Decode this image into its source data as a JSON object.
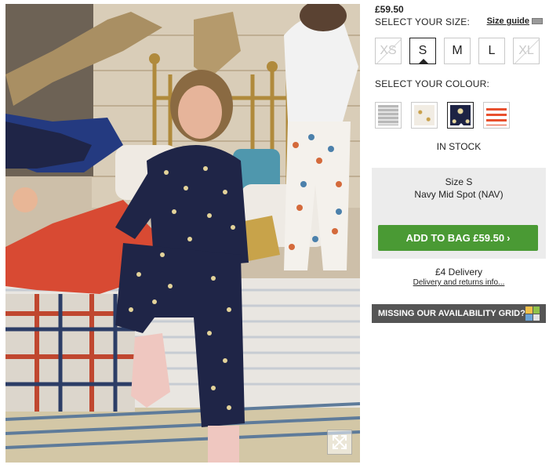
{
  "product": {
    "price": "£59.50",
    "size_label": "SELECT YOUR SIZE:",
    "size_guide": "Size guide",
    "sizes": [
      {
        "label": "XS",
        "available": false,
        "selected": false
      },
      {
        "label": "S",
        "available": true,
        "selected": true
      },
      {
        "label": "M",
        "available": true,
        "selected": false
      },
      {
        "label": "L",
        "available": true,
        "selected": false
      },
      {
        "label": "XL",
        "available": false,
        "selected": false
      }
    ],
    "colour_label": "SELECT YOUR COLOUR:",
    "colours": [
      {
        "name": "grey-stripe",
        "primary": "#b8b8b8",
        "secondary": "#e4e4e4",
        "selected": false
      },
      {
        "name": "ivory-spot",
        "primary": "#f1ece3",
        "secondary": "#c9a04a",
        "selected": false
      },
      {
        "name": "navy-spot",
        "primary": "#1d2344",
        "secondary": "#e9d9a0",
        "selected": true
      },
      {
        "name": "red-stripe",
        "primary": "#e8502e",
        "secondary": "#ffffff",
        "selected": false
      }
    ],
    "stock_status": "IN STOCK"
  },
  "order": {
    "size_text": "Size S",
    "colour_text": "Navy Mid Spot (NAV)",
    "add_button": "ADD TO BAG £59.50",
    "add_button_arrow": "›",
    "add_button_color": "#4a9a34"
  },
  "delivery": {
    "price_text": "£4 Delivery",
    "link_text": "Delivery and returns info..."
  },
  "banner": {
    "text": "MISSING OUR AVAILABILITY GRID?",
    "icon_colors": [
      "#f0c04a",
      "#8fc24a",
      "#6aa3d6",
      "#e3e3e3"
    ]
  },
  "photo": {
    "expand_icon": "expand-arrows-icon"
  }
}
